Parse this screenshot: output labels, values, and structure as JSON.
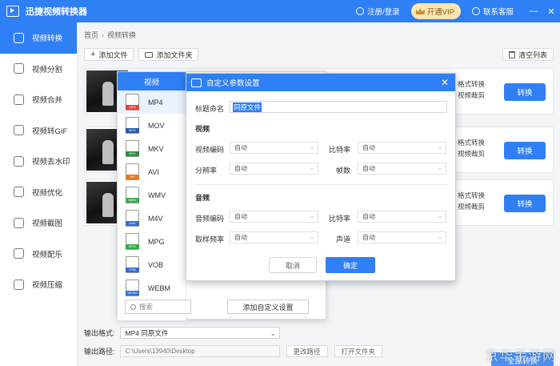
{
  "titlebar": {
    "app_title": "迅捷视频转换器",
    "register_login": "注册/登录",
    "vip_label": "开通VIP",
    "service_label": "联系客服",
    "minimize": "—",
    "close": "✕"
  },
  "sidebar": {
    "items": [
      {
        "label": "视频转换",
        "icon": "convert-icon",
        "active": true
      },
      {
        "label": "视频分割",
        "icon": "split-icon"
      },
      {
        "label": "视频合并",
        "icon": "merge-icon"
      },
      {
        "label": "视频转GIF",
        "icon": "gif-icon"
      },
      {
        "label": "视频去水印",
        "icon": "watermark-remove-icon"
      },
      {
        "label": "视频优化",
        "icon": "optimize-icon"
      },
      {
        "label": "视频截图",
        "icon": "screenshot-icon"
      },
      {
        "label": "视频配乐",
        "icon": "music-icon"
      },
      {
        "label": "视频压缩",
        "icon": "compress-icon"
      }
    ]
  },
  "breadcrumb": {
    "home": "首页",
    "sep": "›",
    "current": "视频转换"
  },
  "toolbar": {
    "add_file": "添加文件",
    "add_folder": "添加文件夹",
    "clear_list": "清空列表"
  },
  "file_rows": [
    {
      "line1": "格式转换",
      "line2": "视频裁剪",
      "button": "转换"
    },
    {
      "line1": "格式转换",
      "line2": "视频裁剪",
      "button": "转换"
    },
    {
      "line1": "格式转换",
      "line2": "视频裁剪",
      "button": "转换"
    }
  ],
  "bottom": {
    "output_format_label": "输出格式:",
    "output_format_value": "MP4   同原文件",
    "output_path_label": "输出路径:",
    "output_path_value": "C:\\Users\\13940\\Desktop",
    "change_path": "更改路径",
    "open_folder": "打开文件夹",
    "convert_all": "全部转换"
  },
  "format_panel": {
    "tab": "视频",
    "formats": [
      {
        "name": "MP4",
        "color": "#e0453a",
        "active": true
      },
      {
        "name": "MOV",
        "color": "#2a5aa8"
      },
      {
        "name": "MKV",
        "color": "#2e8b3e"
      },
      {
        "name": "AVI",
        "color": "#e07b2a"
      },
      {
        "name": "WMV",
        "color": "#3aaa5a"
      },
      {
        "name": "M4V",
        "color": "#2f6fd0"
      },
      {
        "name": "MPG",
        "color": "#38a848"
      },
      {
        "name": "VOB",
        "color": "#2f6fd0"
      },
      {
        "name": "WEBM",
        "color": "#2f6fd0"
      }
    ],
    "search_placeholder": "搜索",
    "add_custom": "添加自定义设置"
  },
  "dialog": {
    "title": "自定义参数设置",
    "close": "✕",
    "name_label": "标题命名",
    "name_value": "同原文件",
    "video_section": "视频",
    "video_codec_label": "视频编码",
    "video_codec_value": "自动",
    "video_bitrate_label": "比特率",
    "video_bitrate_value": "自动",
    "resolution_label": "分辨率",
    "resolution_value": "自动",
    "framerate_label": "帧数",
    "framerate_value": "自动",
    "audio_section": "音频",
    "audio_codec_label": "音频编码",
    "audio_codec_value": "自动",
    "audio_bitrate_label": "比特率",
    "audio_bitrate_value": "自动",
    "samplerate_label": "取样频率",
    "samplerate_value": "自动",
    "channel_label": "声道",
    "channel_value": "自动",
    "cancel": "取消",
    "ok": "确定"
  },
  "watermark": "京华手游网",
  "colors": {
    "primary": "#2f7ff5",
    "vip": "#fde6b2"
  }
}
